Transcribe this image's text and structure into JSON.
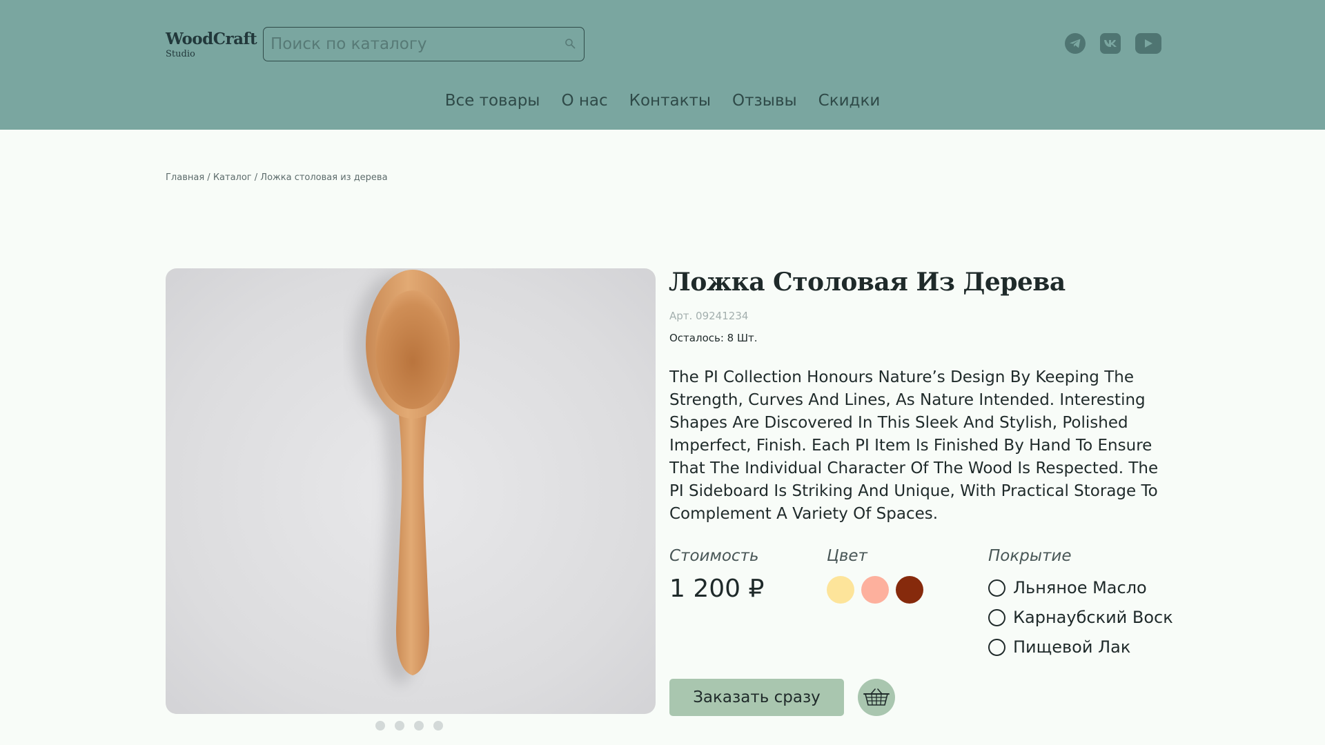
{
  "brand": {
    "name": "WoodCraft",
    "sub": "Studio"
  },
  "search": {
    "placeholder": "Поиск по каталогу",
    "value": ""
  },
  "socials": [
    "telegram-icon",
    "vk-icon",
    "youtube-icon"
  ],
  "nav": [
    "Все товары",
    "О нас",
    "Контакты",
    "Отзывы",
    "Скидки"
  ],
  "breadcrumb": {
    "home": "Главная",
    "sep": " / ",
    "catalog": "Каталог",
    "current": "Ложка столовая из дерева"
  },
  "gallery": {
    "total": 4,
    "active": 1
  },
  "product": {
    "title": "Ложка Столовая Из Дерева",
    "article": "Арт. 09241234",
    "stock": "Осталось: 8 Шт.",
    "description": "The PI Collection Honours Nature’s Design By Keeping The Strength, Curves And Lines, As Nature Intended. Interesting Shapes Are Discovered In This Sleek And Stylish, Polished Imperfect, Finish. Each PI Item Is Finished By Hand To Ensure That The Individual Character Of The Wood Is Respected. The PI Sideboard Is Striking And Unique, With Practical Storage To Complement A Variety Of Spaces."
  },
  "price": {
    "label": "Стоимость",
    "value": "1 200 ₽"
  },
  "colors": {
    "label": "Цвет",
    "swatches": [
      "#fde49a",
      "#fdb09d",
      "#862a0c"
    ]
  },
  "coating": {
    "label": "Покрытие",
    "options": [
      "Льняное Масло",
      "Карнаубский Воск",
      "Пищевой Лак"
    ]
  },
  "actions": {
    "order": "Заказать сразу"
  },
  "theme": {
    "header": "#7aa6a0",
    "button": "#a9c6af",
    "background": "#f8fcf8"
  }
}
